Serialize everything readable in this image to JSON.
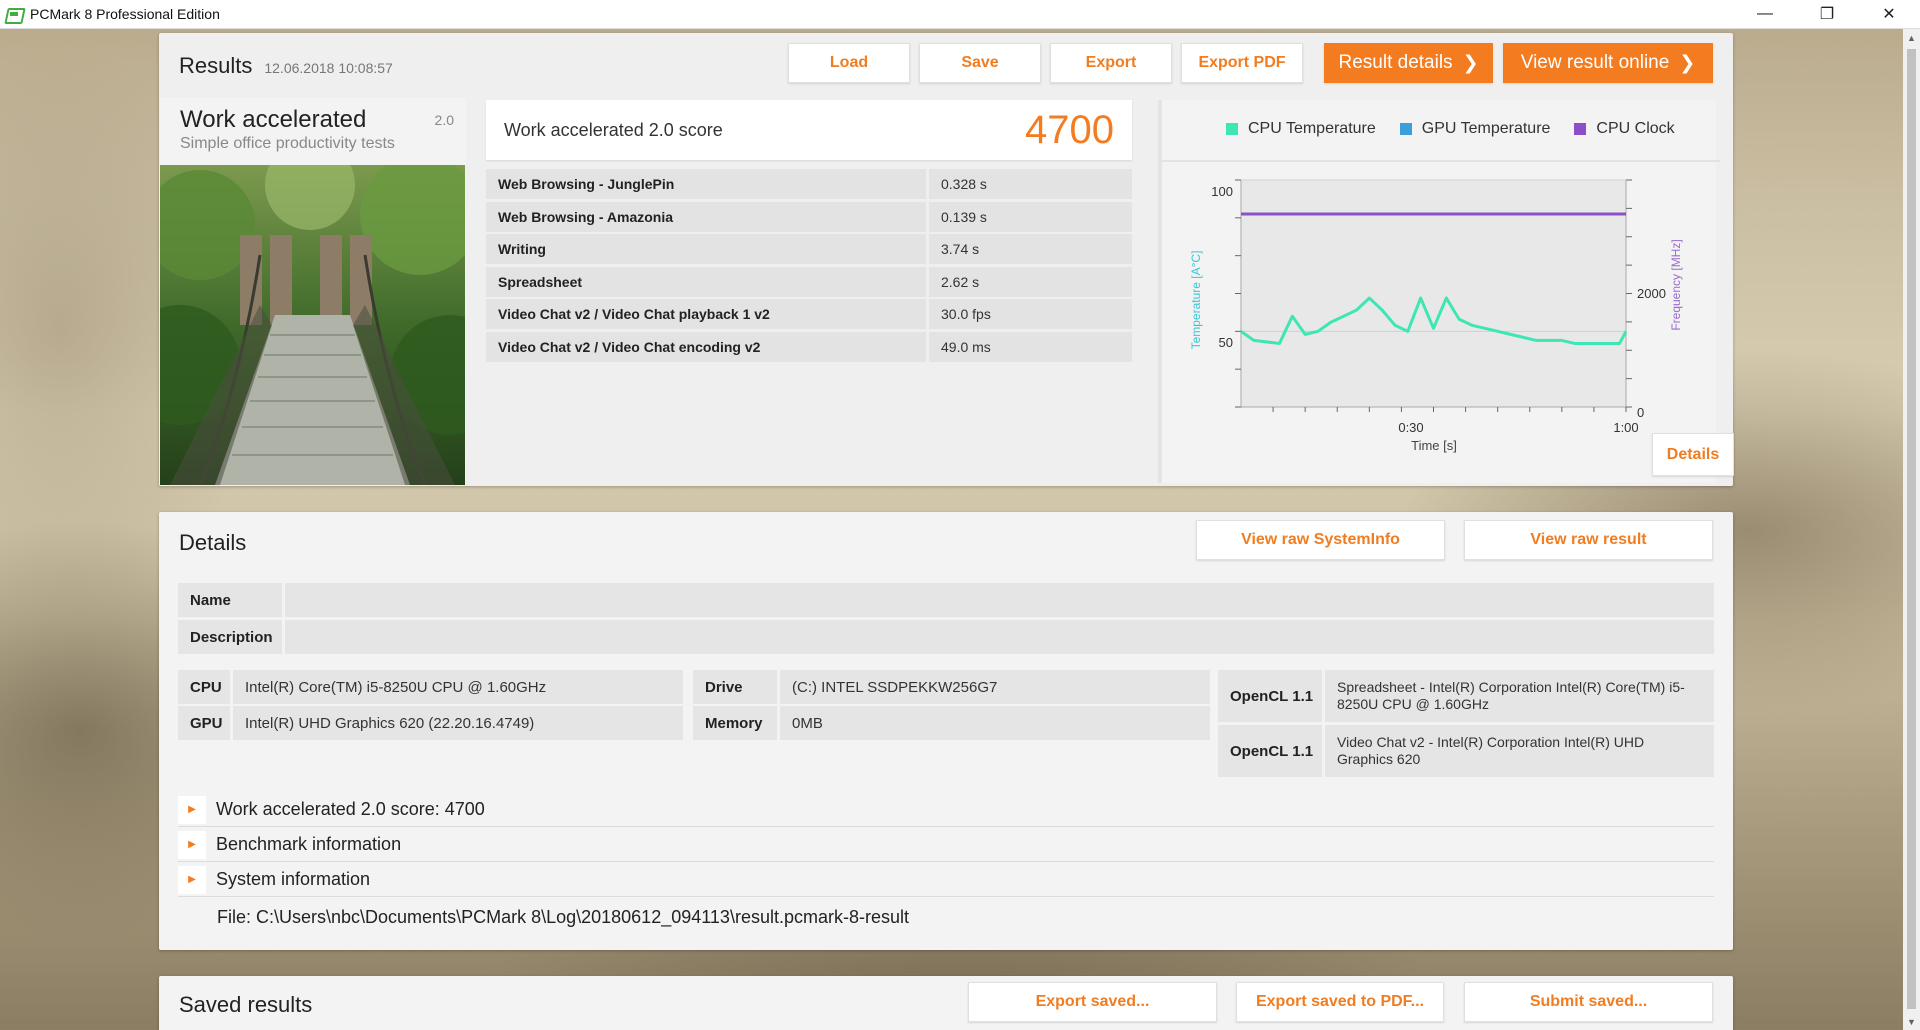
{
  "window": {
    "title": "PCMark 8 Professional Edition",
    "controls": [
      "—",
      "❐",
      "✕"
    ]
  },
  "results": {
    "title": "Results",
    "date": "12.06.2018 10:08:57",
    "buttons": {
      "load": "Load",
      "save": "Save",
      "export": "Export",
      "export_pdf": "Export PDF",
      "result_details": "Result details",
      "view_online": "View result online"
    },
    "test": {
      "name": "Work accelerated",
      "version": "2.0",
      "subtitle": "Simple office productivity tests"
    },
    "score_label": "Work accelerated 2.0 score",
    "score_value": "4700",
    "rows": [
      {
        "name": "Web Browsing - JunglePin",
        "value": "0.328 s"
      },
      {
        "name": "Web Browsing - Amazonia",
        "value": "0.139 s"
      },
      {
        "name": "Writing",
        "value": "3.74 s"
      },
      {
        "name": "Spreadsheet",
        "value": "2.62 s"
      },
      {
        "name": "Video Chat v2 / Video Chat playback 1 v2",
        "value": "30.0 fps"
      },
      {
        "name": "Video Chat v2 / Video Chat encoding v2",
        "value": "49.0 ms"
      }
    ],
    "chart": {
      "legend": [
        {
          "name": "CPU Temperature",
          "color": "#3ee6b4"
        },
        {
          "name": "GPU Temperature",
          "color": "#3aa0dc"
        },
        {
          "name": "CPU Clock",
          "color": "#8b4fc8"
        }
      ],
      "y_left_label": "Temperature [A°C]",
      "y_right_label": "Frequency [MHz]",
      "x_label": "Time [s]",
      "y_left_ticks": [
        "100",
        "50"
      ],
      "y_right_ticks": [
        "2000",
        "0"
      ],
      "x_ticks": [
        "0:30",
        "1:00"
      ],
      "details_label": "Details"
    }
  },
  "chart_data": {
    "type": "line",
    "xlabel": "Time [s]",
    "ylabel": "Temperature [A°C]",
    "ylabel_right": "Frequency [MHz]",
    "xlim": [
      0,
      60
    ],
    "ylim": [
      25,
      100
    ],
    "ylim_right": [
      0,
      4000
    ],
    "series": [
      {
        "name": "CPU Temperature",
        "axis": "left",
        "x": [
          0,
          2,
          6,
          8,
          10,
          12,
          14,
          16,
          18,
          20,
          22,
          24,
          26,
          28,
          30,
          32,
          34,
          36,
          38,
          40,
          42,
          44,
          46,
          48,
          50,
          52,
          54,
          56,
          58,
          59,
          60
        ],
        "values": [
          50,
          47,
          46,
          55,
          49,
          50,
          53,
          55,
          57,
          61,
          57,
          52,
          50,
          61,
          51,
          61,
          54,
          52,
          51,
          50,
          49,
          48,
          47,
          47,
          47,
          46,
          46,
          46,
          46,
          46,
          50
        ]
      },
      {
        "name": "GPU Temperature",
        "axis": "left",
        "x": [],
        "values": []
      },
      {
        "name": "CPU Clock",
        "axis": "right",
        "x": [
          0,
          60
        ],
        "values": [
          3400,
          3400
        ]
      }
    ]
  },
  "details": {
    "title": "Details",
    "buttons": {
      "sysinfo": "View raw SystemInfo",
      "raw_result": "View raw result"
    },
    "name_label": "Name",
    "name_value": "",
    "description_label": "Description",
    "description_value": "",
    "cpu_label": "CPU",
    "cpu_value": "Intel(R) Core(TM) i5-8250U CPU @ 1.60GHz",
    "gpu_label": "GPU",
    "gpu_value": "Intel(R) UHD Graphics 620 (22.20.16.4749)",
    "drive_label": "Drive",
    "drive_value": "(C:) INTEL SSDPEKKW256G7",
    "memory_label": "Memory",
    "memory_value": "0MB",
    "opencl1_label": "OpenCL 1.1",
    "opencl1_value": "Spreadsheet - Intel(R) Corporation Intel(R) Core(TM) i5-8250U CPU @ 1.60GHz",
    "opencl2_label": "OpenCL 1.1",
    "opencl2_value": "Video Chat v2 - Intel(R) Corporation Intel(R) UHD Graphics 620",
    "expanders": [
      "Work accelerated 2.0 score: 4700",
      "Benchmark information",
      "System information"
    ],
    "file": "File: C:\\Users\\nbc\\Documents\\PCMark 8\\Log\\20180612_094113\\result.pcmark-8-result"
  },
  "saved": {
    "title": "Saved results",
    "buttons": {
      "export_saved": "Export saved...",
      "export_saved_pdf": "Export saved to PDF...",
      "submit_saved": "Submit saved..."
    }
  }
}
